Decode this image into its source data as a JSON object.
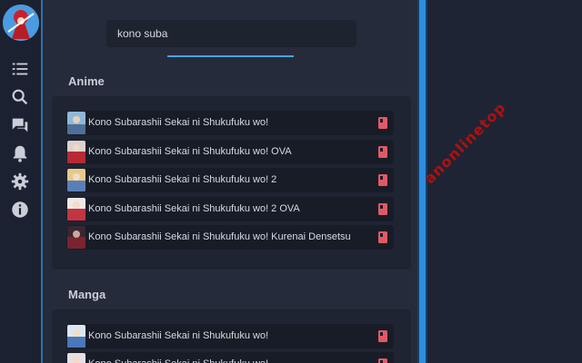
{
  "search": {
    "value": "kono suba",
    "placeholder": ""
  },
  "sections": {
    "anime": {
      "title": "Anime",
      "items": [
        {
          "label": "Kono Subarashii Sekai ni Shukufuku wo!"
        },
        {
          "label": "Kono Subarashii Sekai ni Shukufuku wo! OVA"
        },
        {
          "label": "Kono Subarashii Sekai ni Shukufuku wo! 2"
        },
        {
          "label": "Kono Subarashii Sekai ni Shukufuku wo! 2 OVA"
        },
        {
          "label": "Kono Subarashii Sekai ni Shukufuku wo! Kurenai Densetsu"
        }
      ]
    },
    "manga": {
      "title": "Manga",
      "items": [
        {
          "label": "Kono Subarashii Sekai ni Shukufuku wo!"
        },
        {
          "label": "Kono Subarashii Sekai ni Shukufuku wo!"
        }
      ]
    }
  },
  "icons": {
    "rail": [
      "list-icon",
      "search-icon",
      "forum-icon",
      "bell-icon",
      "gear-icon",
      "info-icon"
    ],
    "badge": "bookmark-icon"
  },
  "colors": {
    "accent": "#4aa3e8",
    "badge": "#e05a66",
    "background": "#1e2433",
    "panel": "#252b3a"
  },
  "watermark": "anonlinetop"
}
